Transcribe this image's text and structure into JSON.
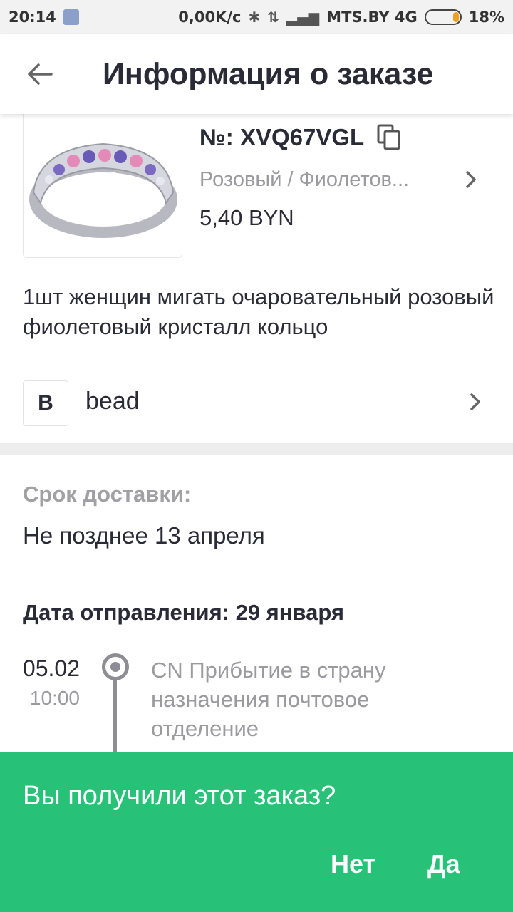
{
  "status_bar": {
    "time": "20:14",
    "speed": "0,00K/c",
    "carrier": "MTS.BY 4G",
    "battery": "18%",
    "battery_level": 0.18
  },
  "header": {
    "title": "Информация о заказе"
  },
  "product": {
    "order_number": "№: XVQ67VGL",
    "variant": "Розовый / Фиолетов...",
    "price": "5,40 BYN",
    "description": "1шт женщин мигать очаровательный розовый фиолетовый кристалл кольцо",
    "image_icon": "ring-product-image"
  },
  "store": {
    "badge": "B",
    "name": "bead"
  },
  "delivery": {
    "label": "Срок доставки:",
    "value": "Не позднее 13 апреля"
  },
  "shipping": {
    "date_line": "Дата отправления: 29 января"
  },
  "tracking": [
    {
      "date": "05.02",
      "time": "10:00",
      "status": "CN Прибытие в страну назначения почтовое отделение"
    }
  ],
  "prompt": {
    "question": "Вы получили этот заказ?",
    "no_label": "Нет",
    "yes_label": "Да",
    "background": "#27c278"
  }
}
